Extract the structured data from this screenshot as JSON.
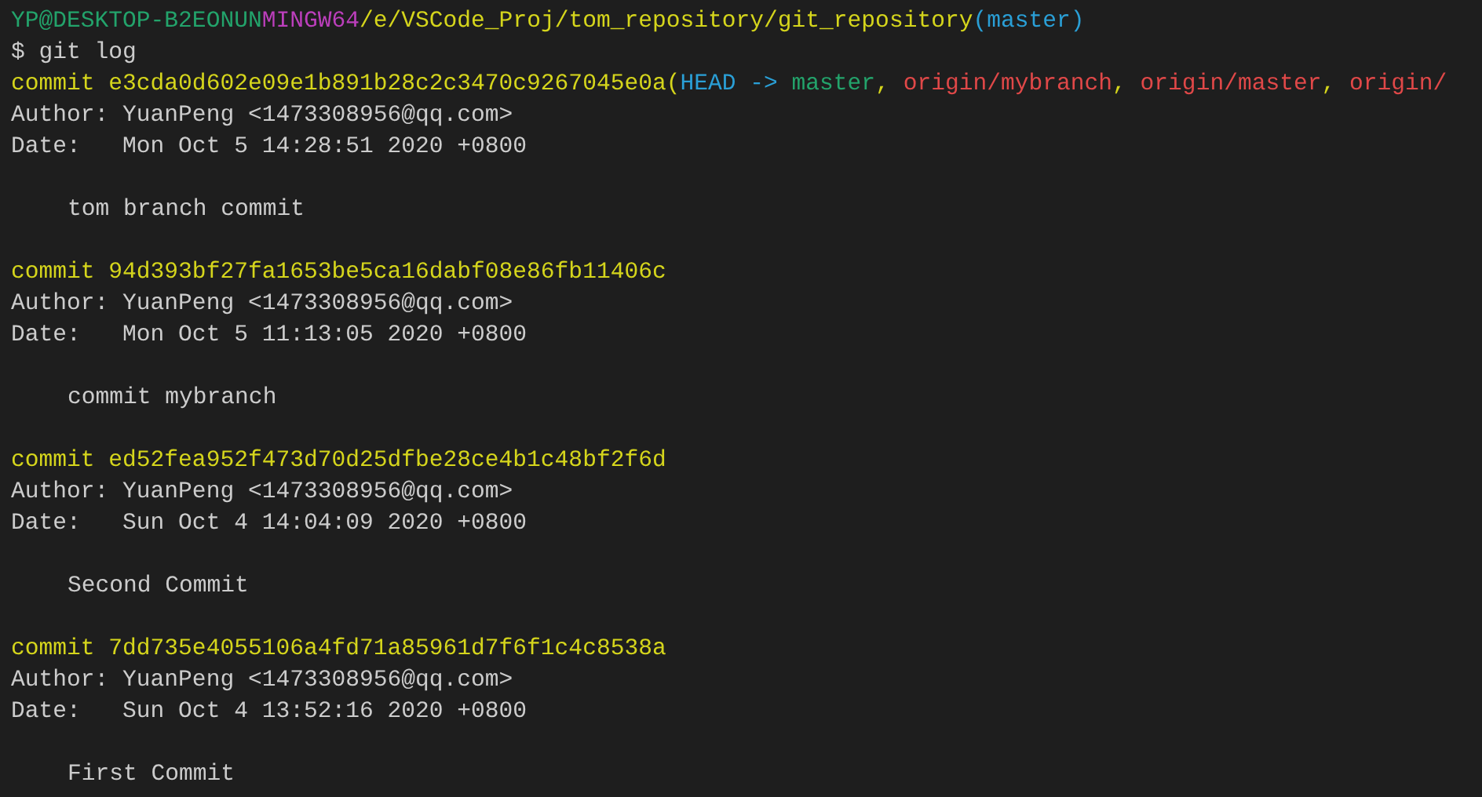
{
  "prompt": {
    "user_host": "YP@DESKTOP-B2EONUN",
    "system": "MINGW64",
    "path": "/e/VSCode_Proj/tom_repository/git_repository",
    "branch": "(master)"
  },
  "command": "$ git log",
  "commits": [
    {
      "commit": "commit e3cda0d602e09e1b891b28c2c3470c9267045e0a",
      "refs": [
        {
          "kind": "punct",
          "text": "("
        },
        {
          "kind": "head",
          "text": "HEAD -> "
        },
        {
          "kind": "local",
          "text": "master"
        },
        {
          "kind": "punct",
          "text": ", "
        },
        {
          "kind": "remote",
          "text": "origin/mybranch"
        },
        {
          "kind": "punct",
          "text": ", "
        },
        {
          "kind": "remote",
          "text": "origin/master"
        },
        {
          "kind": "punct",
          "text": ", "
        },
        {
          "kind": "remote",
          "text": "origin/"
        }
      ],
      "author": "Author: YuanPeng <1473308956@qq.com>",
      "date": "Date:   Mon Oct 5 14:28:51 2020 +0800",
      "message": "tom branch commit"
    },
    {
      "commit": "commit 94d393bf27fa1653be5ca16dabf08e86fb11406c",
      "author": "Author: YuanPeng <1473308956@qq.com>",
      "date": "Date:   Mon Oct 5 11:13:05 2020 +0800",
      "message": "commit mybranch"
    },
    {
      "commit": "commit ed52fea952f473d70d25dfbe28ce4b1c48bf2f6d",
      "author": "Author: YuanPeng <1473308956@qq.com>",
      "date": "Date:   Sun Oct 4 14:04:09 2020 +0800",
      "message": "Second Commit"
    },
    {
      "commit": "commit 7dd735e4055106a4fd71a85961d7f6f1c4c8538a",
      "author": "Author: YuanPeng <1473308956@qq.com>",
      "date": "Date:   Sun Oct 4 13:52:16 2020 +0800",
      "message": "First Commit"
    }
  ]
}
